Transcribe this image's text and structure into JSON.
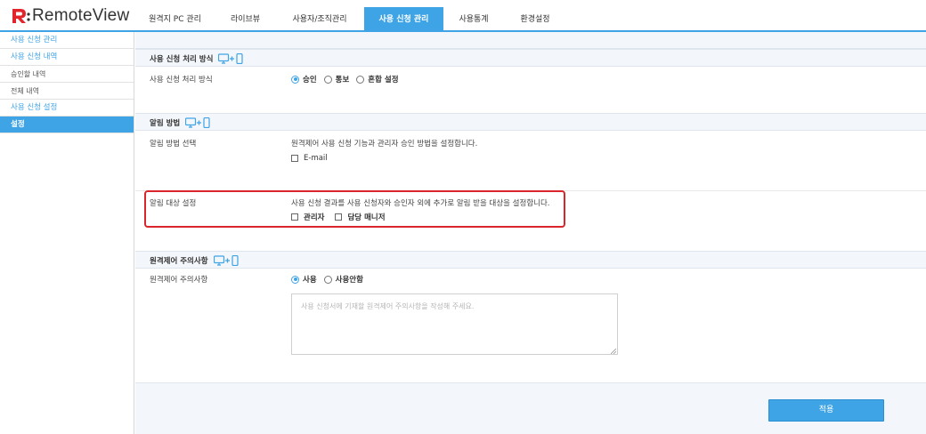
{
  "logo": {
    "text": "RemoteView"
  },
  "nav": {
    "tabs": [
      {
        "label": "원격지 PC 관리",
        "active": false
      },
      {
        "label": "라이브뷰",
        "active": false
      },
      {
        "label": "사용자/조직관리",
        "active": false
      },
      {
        "label": "사용 신청 관리",
        "active": true
      },
      {
        "label": "사용통계",
        "active": false
      },
      {
        "label": "환경설정",
        "active": false
      }
    ]
  },
  "sidebar": {
    "items": [
      {
        "label": "사용 신청 관리"
      },
      {
        "label": "사용 신청 내역"
      },
      {
        "label": "승인할 내역"
      },
      {
        "label": "전체 내역"
      },
      {
        "label": "사용 신청 설정"
      },
      {
        "label": "설정"
      }
    ]
  },
  "sections": {
    "processing": {
      "title": "사용 신청 처리 방식",
      "row_label": "사용 신청 처리 방식",
      "options": [
        {
          "label": "승인",
          "checked": true
        },
        {
          "label": "통보",
          "checked": false
        },
        {
          "label": "혼합 설정",
          "checked": false
        }
      ]
    },
    "notification": {
      "title": "알림 방법",
      "method_label": "알림 방법 선택",
      "method_desc": "원격제어 사용 신청 기능과 관리자 승인 방법을 설정합니다.",
      "method_option": "E-mail",
      "target_label": "알림 대상 설정",
      "target_desc": "사용 신청 결과를 사용 신청자와 승인자 외에 추가로 알림 받을 대상을 설정합니다.",
      "target_options": [
        {
          "label": "관리자",
          "checked": false
        },
        {
          "label": "담당 매니저",
          "checked": false
        }
      ]
    },
    "caution": {
      "title": "원격제어 주의사항",
      "row_label": "원격제어 주의사항",
      "options": [
        {
          "label": "사용",
          "checked": true
        },
        {
          "label": "사용안함",
          "checked": false
        }
      ],
      "placeholder": "사용 신청서에 기재할 원격제어 주의사항을 작성해 주세요."
    }
  },
  "apply_button": {
    "label": "적용"
  },
  "colors": {
    "accent": "#3fa4e6",
    "highlight": "#d9252b",
    "brand_red": "#e2242b"
  },
  "icons": {
    "device": "monitor-plus-phone-icon"
  }
}
